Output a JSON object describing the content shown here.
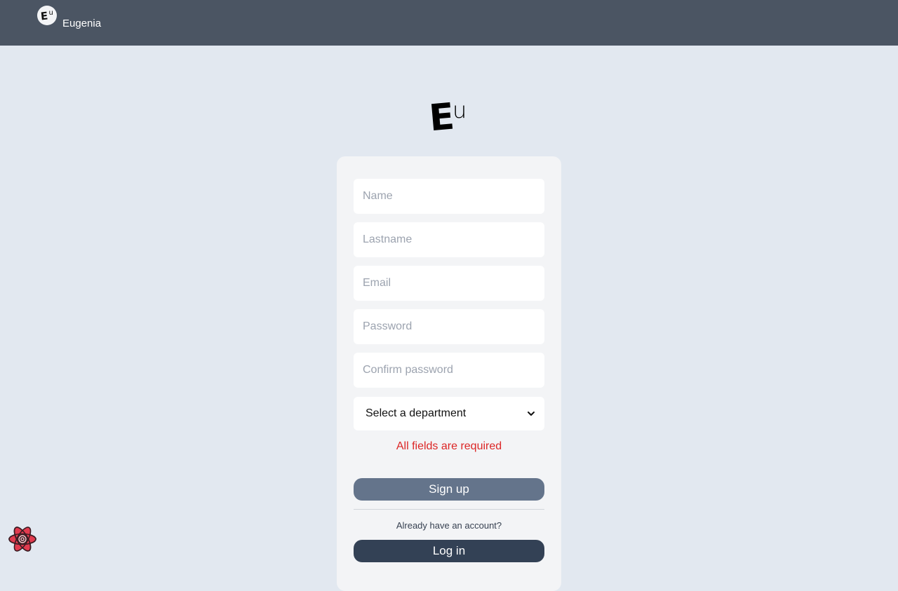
{
  "header": {
    "brand_name": "Eugenia",
    "brand_logo_text_big": "E",
    "brand_logo_text_small": "u"
  },
  "logo": {
    "big": "E",
    "small": "u"
  },
  "form": {
    "name_placeholder": "Name",
    "lastname_placeholder": "Lastname",
    "email_placeholder": "Email",
    "password_placeholder": "Password",
    "confirm_password_placeholder": "Confirm password",
    "department_selected": "Select a department",
    "error_message": "All fields are required",
    "signup_label": "Sign up",
    "already_text": "Already have an account?",
    "login_label": "Log in"
  },
  "icons": {
    "dropdown": "chevron-down-icon",
    "devtools": "react-icon"
  },
  "colors": {
    "header_bg": "#4b5563",
    "page_bg": "#e2e8f0",
    "card_bg": "#f3f4f6",
    "error": "#dc2626",
    "signup_bg": "#64748b",
    "login_bg": "#334155",
    "react_accent": "#e23b4f"
  }
}
